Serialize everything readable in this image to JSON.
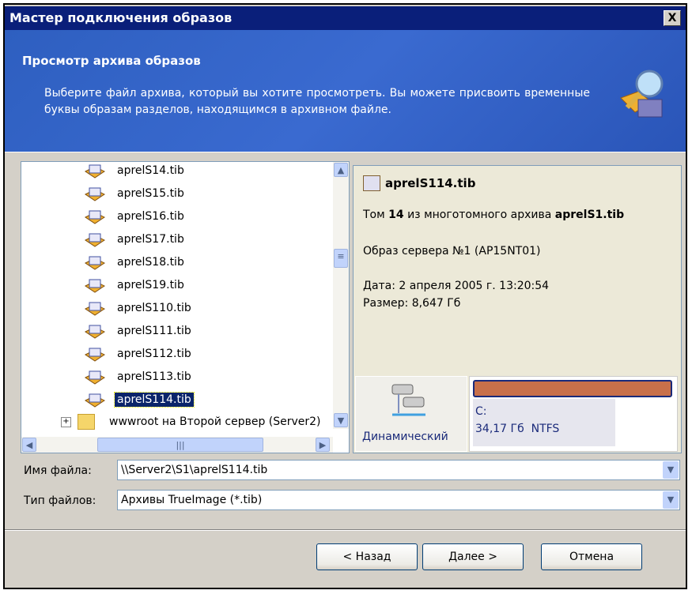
{
  "window": {
    "title": "Мастер подключения образов",
    "close": "X"
  },
  "header": {
    "title": "Просмотр архива образов",
    "description": "Выберите файл архива, который вы хотите просмотреть. Вы можете присвоить временные буквы образам разделов, находящимся в архивном файле."
  },
  "tree": {
    "items": [
      "aprelS14.tib",
      "aprelS15.tib",
      "aprelS16.tib",
      "aprelS17.tib",
      "aprelS18.tib",
      "aprelS19.tib",
      "aprelS110.tib",
      "aprelS111.tib",
      "aprelS112.tib",
      "aprelS113.tib",
      "aprelS114.tib"
    ],
    "selected": "aprelS114.tib",
    "folder": "wwwroot на Второй сервер (Server2)"
  },
  "info": {
    "filename": "aprelS114.tib",
    "volume_prefix": "Том ",
    "volume_num": "14",
    "volume_mid": " из многотомного архива ",
    "archive": "aprelS1.tib",
    "image": "Образ сервера №1 (AP15NT01)",
    "date": "Дата: 2 апреля 2005 г. 13:20:54",
    "size": "Размер: 8,647 Гб",
    "disk_type": "Динамический",
    "partition_letter": "C:",
    "partition_info": "34,17 Гб  NTFS",
    "partition_color": "#C8704A"
  },
  "fields": {
    "filename_label": "Имя файла:",
    "filename_value": "\\\\Server2\\S1\\aprelS114.tib",
    "type_label": "Тип файлов:",
    "type_value": "Архивы TrueImage (*.tib)"
  },
  "buttons": {
    "back": "< Назад",
    "next": "Далее >",
    "cancel": "Отмена"
  }
}
